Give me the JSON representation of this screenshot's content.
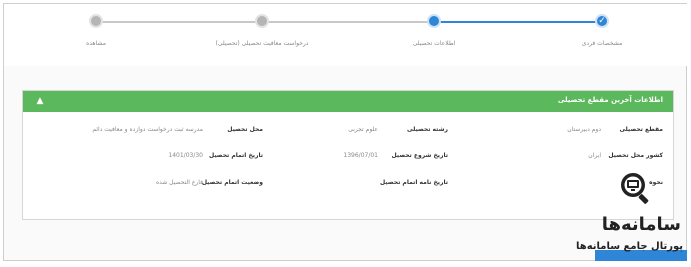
{
  "stepper": {
    "steps": [
      {
        "label": "مشخصات فردی",
        "state": "done"
      },
      {
        "label": "اطلاعات تحصیلی",
        "state": "active"
      },
      {
        "label": "درخواست معافیت تحصیلی (تحصیلی)",
        "state": "pending"
      },
      {
        "label": "مشاهده",
        "state": "pending"
      }
    ],
    "check_glyph": "✓"
  },
  "panel": {
    "title": "اطلاعات آخرین مقطع تحصیلی",
    "collapse_glyph": "▲",
    "fields": {
      "grade": {
        "label": "مقطع تحصیلی",
        "value": "دوم دبیرستان"
      },
      "field": {
        "label": "رشته تحصیلی",
        "value": "علوم تجربی"
      },
      "status": {
        "label": "محل تحصیل",
        "value": "مدرسه ثبت درخواست دوازده و معافیت دائم"
      },
      "country": {
        "label": "کشور محل تحصیل",
        "value": "ایران"
      },
      "start_date": {
        "label": "تاریخ شروع تحصیل",
        "value": "1396/07/01"
      },
      "end_date": {
        "label": "تاریخ اتمام تحصیل",
        "value": "1401/03/30"
      },
      "cert_date": {
        "label": "تاریخ نامه اتمام تحصیل",
        "value": ""
      },
      "end_status": {
        "label": "وضعیت اتمام تحصیل",
        "value": "فارغ التحصیل شده"
      },
      "row3_first_label": "نحوه"
    }
  },
  "watermark": {
    "title": "سامانه‌ها",
    "subtitle": "پورتال جامع سامانه‌ها"
  },
  "colors": {
    "accent": "#2f86d6",
    "panel_header": "#5cb85c"
  }
}
